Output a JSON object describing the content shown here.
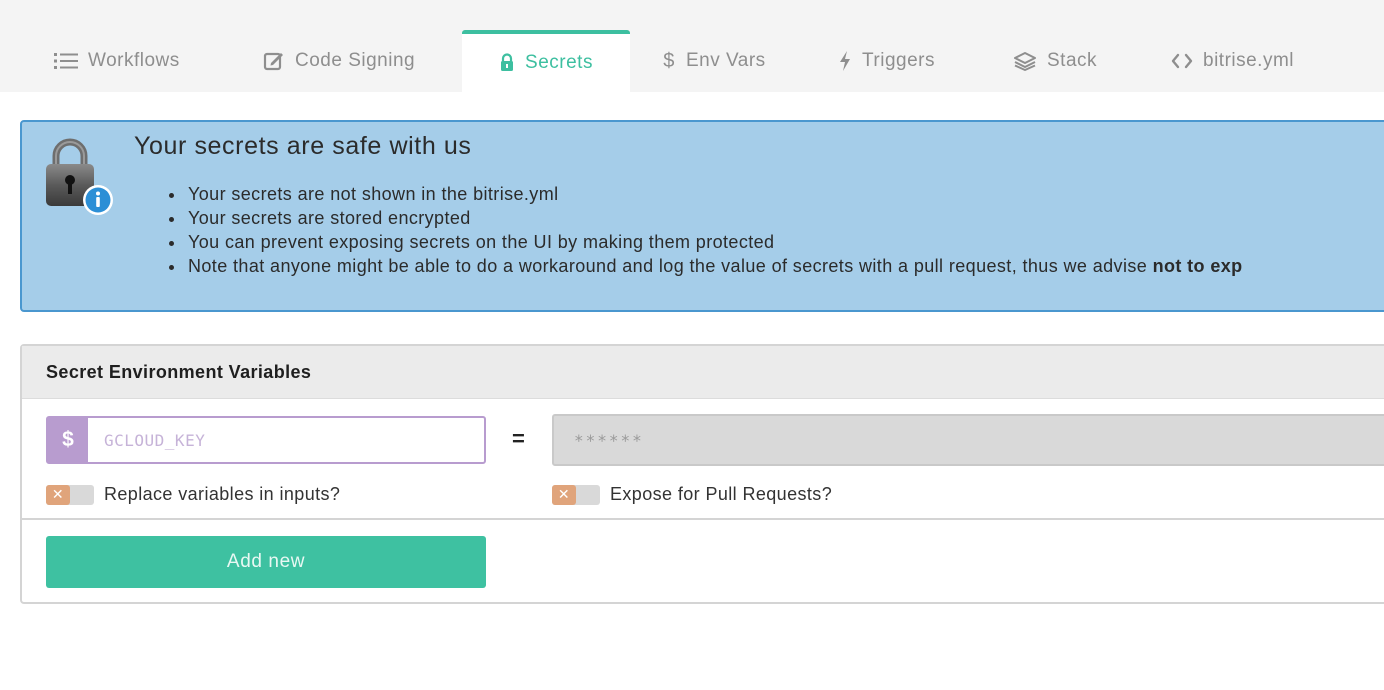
{
  "tabs": [
    {
      "label": "Workflows",
      "icon": "list-icon",
      "active": false
    },
    {
      "label": "Code Signing",
      "icon": "edit-icon",
      "active": false
    },
    {
      "label": "Secrets",
      "icon": "lock-icon",
      "active": true
    },
    {
      "label": "Env Vars",
      "icon": "dollar-icon",
      "active": false
    },
    {
      "label": "Triggers",
      "icon": "lightning-icon",
      "active": false
    },
    {
      "label": "Stack",
      "icon": "layers-icon",
      "active": false
    },
    {
      "label": "bitrise.yml",
      "icon": "code-icon",
      "active": false
    }
  ],
  "banner": {
    "title": "Your secrets are safe with us",
    "items": [
      "Your secrets are not shown in the bitrise.yml",
      "Your secrets are stored encrypted",
      "You can prevent exposing secrets on the UI by making them protected"
    ],
    "last_item_text": "Note that anyone might be able to do a workaround and log the value of secrets with a pull request, thus we advise ",
    "last_item_bold": "not to exp"
  },
  "panel": {
    "title": "Secret Environment Variables",
    "key_prefix": "$",
    "key_placeholder": "GCLOUD_KEY",
    "equals": "=",
    "value_placeholder": "******",
    "replace_label": "Replace variables in inputs?",
    "expose_label": "Expose for Pull Requests?",
    "toggle_mark": "✕",
    "add_button": "Add new"
  },
  "colors": {
    "accent": "#3dbfa0",
    "banner_bg": "#a5cde9",
    "banner_border": "#4a97cf",
    "key_purple": "#b89ccf",
    "toggle_off": "#e0a47b"
  }
}
